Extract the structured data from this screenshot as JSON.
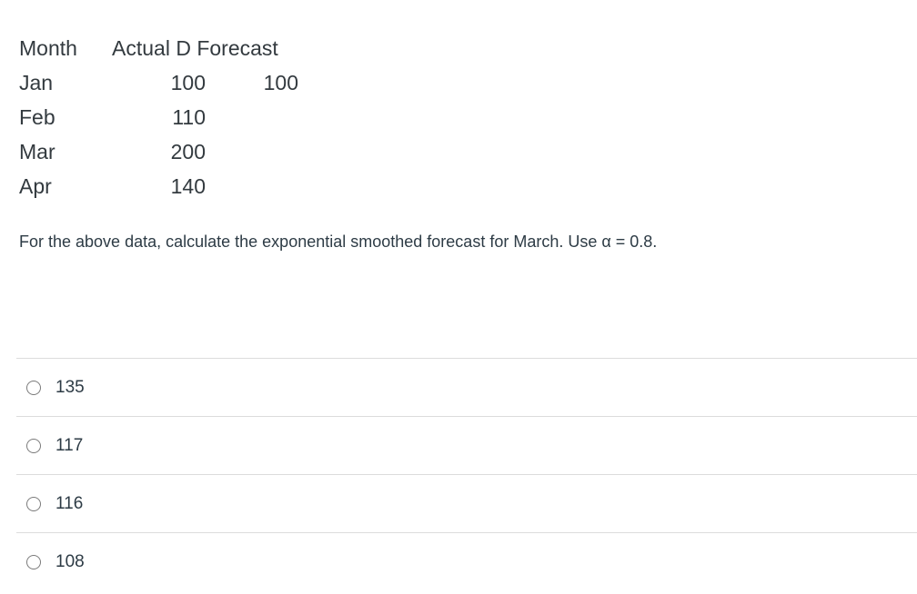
{
  "table": {
    "headers": [
      "Month",
      "Actual D",
      "Forecast"
    ],
    "rows": [
      {
        "month": "Jan",
        "actual": "100",
        "forecast": "100"
      },
      {
        "month": "Feb",
        "actual": "110",
        "forecast": ""
      },
      {
        "month": "Mar",
        "actual": "200",
        "forecast": ""
      },
      {
        "month": "Apr",
        "actual": "140",
        "forecast": ""
      }
    ]
  },
  "question": "For the above data, calculate the exponential smoothed forecast for March. Use α = 0.8.",
  "answers": [
    {
      "label": "135",
      "selected": false
    },
    {
      "label": "117",
      "selected": false
    },
    {
      "label": "116",
      "selected": false
    },
    {
      "label": "108",
      "selected": false
    }
  ]
}
